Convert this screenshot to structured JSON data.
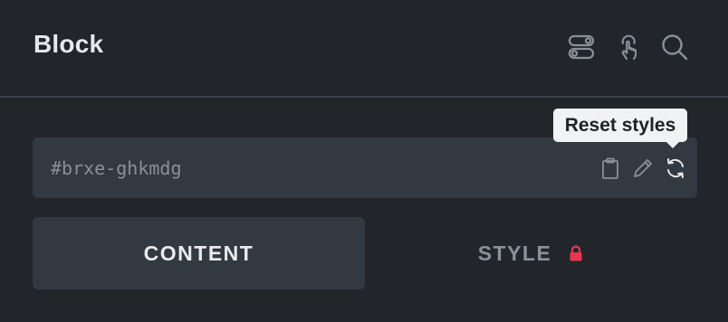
{
  "header": {
    "title": "Block",
    "icons": [
      "toggle-icon",
      "hand-pointer-icon",
      "search-icon"
    ]
  },
  "element_id": {
    "value": "#brxe-ghkmdg",
    "icons": [
      "clipboard-icon",
      "pencil-icon",
      "reset-icon"
    ]
  },
  "tooltip": {
    "text": "Reset styles"
  },
  "tabs": [
    {
      "label": "CONTENT",
      "active": true
    },
    {
      "label": "STYLE",
      "active": false,
      "locked": true
    }
  ],
  "colors": {
    "background": "#22262b",
    "panel": "#323941",
    "lock": "#e8364f",
    "tooltip_bg": "#f1f2f3"
  }
}
